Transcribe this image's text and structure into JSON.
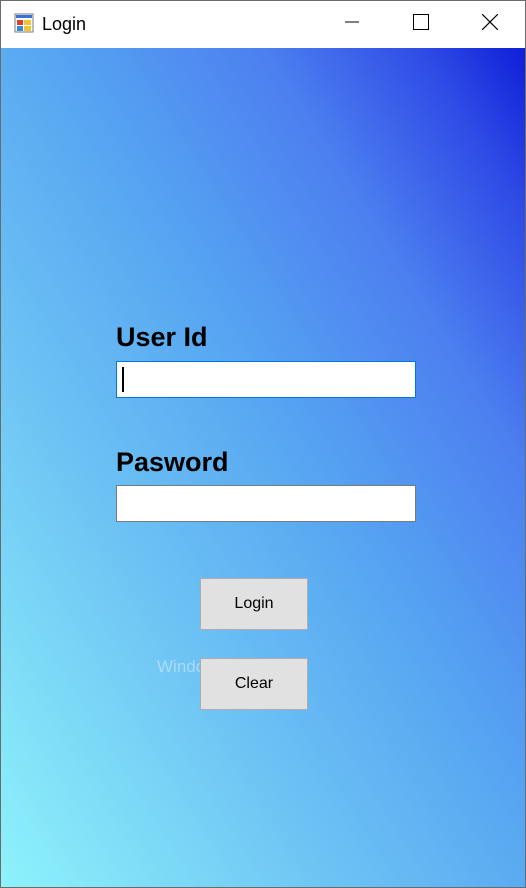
{
  "window": {
    "title": "Login",
    "icon": "winforms-app-icon",
    "controls": {
      "minimize_icon": "minimize-icon",
      "maximize_icon": "maximize-icon",
      "close_icon": "close-icon"
    }
  },
  "form": {
    "user_id_label": "User Id",
    "user_id_value": "",
    "password_label": "Pasword",
    "password_value": "",
    "login_button": "Login",
    "clear_button": "Clear",
    "background_colors": [
      "#8ef3fb",
      "#56a4f2",
      "#0f1ed8"
    ]
  },
  "overlay": {
    "watermark": "Window Snip"
  }
}
